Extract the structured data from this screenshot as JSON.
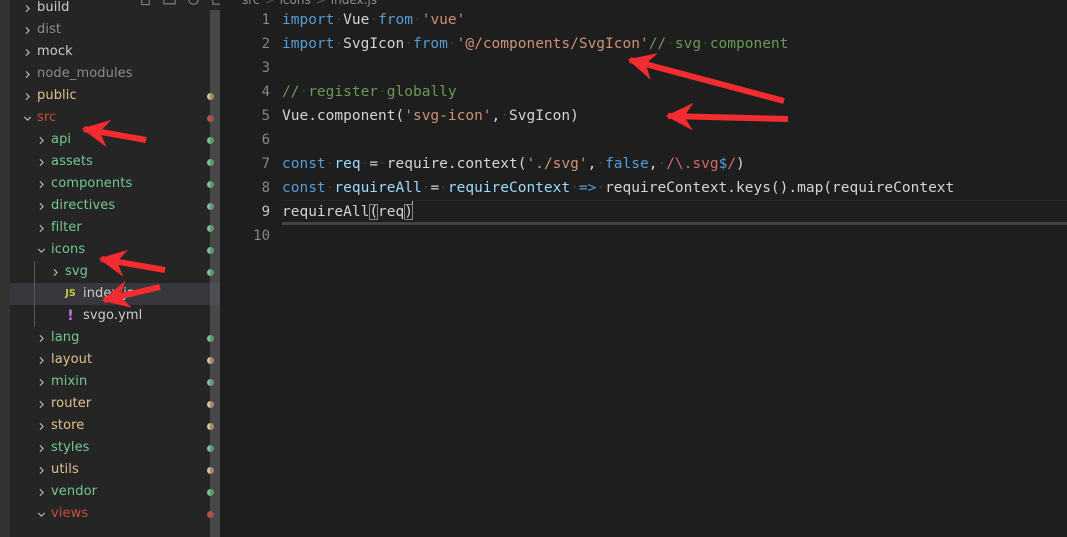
{
  "window": {
    "theme": "dark-plus",
    "accent_red": "#f22c30",
    "editor_bg": "#1e1e1e",
    "sidebar_bg": "#252526"
  },
  "toolbar": {
    "icons": [
      {
        "name": "new-file-icon",
        "glyph": "new-file"
      },
      {
        "name": "new-folder-icon",
        "glyph": "new-folder"
      },
      {
        "name": "refresh-explorer-icon",
        "glyph": "refresh"
      },
      {
        "name": "collapse-folders-icon",
        "glyph": "collapse"
      }
    ]
  },
  "breadcrumb": {
    "parts": [
      "src",
      "icons",
      "index.js"
    ]
  },
  "sidebar": {
    "scrollbar": {
      "name": "sidebar-scrollbar"
    },
    "items": [
      {
        "label": "build",
        "type": "folder",
        "state": "collapsed",
        "indent": 0,
        "color": "#cccccc",
        "dot": null,
        "selected": false
      },
      {
        "label": "dist",
        "type": "folder",
        "state": "collapsed",
        "indent": 0,
        "color": "#8c8c8c",
        "dot": null,
        "selected": false
      },
      {
        "label": "mock",
        "type": "folder",
        "state": "collapsed",
        "indent": 0,
        "color": "#cccccc",
        "dot": null,
        "selected": false
      },
      {
        "label": "node_modules",
        "type": "folder",
        "state": "collapsed",
        "indent": 0,
        "color": "#8c8c8c",
        "dot": null,
        "selected": false
      },
      {
        "label": "public",
        "type": "folder",
        "state": "collapsed",
        "indent": 0,
        "color": "#e2c08d",
        "dot": "#e2c08d",
        "selected": false
      },
      {
        "label": "src",
        "type": "folder",
        "state": "expanded",
        "indent": 0,
        "color": "#c74e39",
        "dot": "#c74e39",
        "selected": false
      },
      {
        "label": "api",
        "type": "folder",
        "state": "collapsed",
        "indent": 1,
        "color": "#73c991",
        "dot": "#73c991",
        "selected": false
      },
      {
        "label": "assets",
        "type": "folder",
        "state": "collapsed",
        "indent": 1,
        "color": "#73c991",
        "dot": "#73c991",
        "selected": false
      },
      {
        "label": "components",
        "type": "folder",
        "state": "collapsed",
        "indent": 1,
        "color": "#73c991",
        "dot": "#73c991",
        "selected": false
      },
      {
        "label": "directives",
        "type": "folder",
        "state": "collapsed",
        "indent": 1,
        "color": "#73c991",
        "dot": "#73c991",
        "selected": false
      },
      {
        "label": "filter",
        "type": "folder",
        "state": "collapsed",
        "indent": 1,
        "color": "#73c991",
        "dot": "#73c991",
        "selected": false
      },
      {
        "label": "icons",
        "type": "folder",
        "state": "expanded",
        "indent": 1,
        "color": "#73c991",
        "dot": "#73c991",
        "selected": false
      },
      {
        "label": "svg",
        "type": "folder",
        "state": "collapsed",
        "indent": 2,
        "color": "#73c991",
        "dot": "#73c991",
        "selected": false
      },
      {
        "label": "index.js",
        "type": "file",
        "state": "none",
        "indent": 2,
        "color": "#cccccc",
        "dot": null,
        "selected": true,
        "icon": "js"
      },
      {
        "label": "svgo.yml",
        "type": "file",
        "state": "none",
        "indent": 2,
        "color": "#cccccc",
        "dot": null,
        "selected": false,
        "icon": "yml"
      },
      {
        "label": "lang",
        "type": "folder",
        "state": "collapsed",
        "indent": 1,
        "color": "#73c991",
        "dot": "#73c991",
        "selected": false
      },
      {
        "label": "layout",
        "type": "folder",
        "state": "collapsed",
        "indent": 1,
        "color": "#e2c08d",
        "dot": "#e2c08d",
        "selected": false
      },
      {
        "label": "mixin",
        "type": "folder",
        "state": "collapsed",
        "indent": 1,
        "color": "#73c991",
        "dot": "#73c991",
        "selected": false
      },
      {
        "label": "router",
        "type": "folder",
        "state": "collapsed",
        "indent": 1,
        "color": "#e2c08d",
        "dot": "#e2c08d",
        "selected": false
      },
      {
        "label": "store",
        "type": "folder",
        "state": "collapsed",
        "indent": 1,
        "color": "#e2c08d",
        "dot": "#e2c08d",
        "selected": false
      },
      {
        "label": "styles",
        "type": "folder",
        "state": "collapsed",
        "indent": 1,
        "color": "#73c991",
        "dot": "#73c991",
        "selected": false
      },
      {
        "label": "utils",
        "type": "folder",
        "state": "collapsed",
        "indent": 1,
        "color": "#e2c08d",
        "dot": "#e2c08d",
        "selected": false
      },
      {
        "label": "vendor",
        "type": "folder",
        "state": "collapsed",
        "indent": 1,
        "color": "#73c991",
        "dot": "#73c991",
        "selected": false
      },
      {
        "label": "views",
        "type": "folder",
        "state": "expanded",
        "indent": 1,
        "color": "#c74e39",
        "dot": "#c74e39",
        "selected": false
      }
    ]
  },
  "editor": {
    "filename": "index.js",
    "language": "javascript",
    "active_line": 9,
    "lines": [
      {
        "no": "1",
        "tokens": [
          {
            "t": "import",
            "c": "t-kw"
          },
          {
            "t": "·",
            "c": "ws"
          },
          {
            "t": "Vue",
            "c": "t-plain"
          },
          {
            "t": "·",
            "c": "ws"
          },
          {
            "t": "from",
            "c": "t-kw"
          },
          {
            "t": "·",
            "c": "ws"
          },
          {
            "t": "'vue'",
            "c": "t-str"
          }
        ]
      },
      {
        "no": "2",
        "tokens": [
          {
            "t": "import",
            "c": "t-kw"
          },
          {
            "t": "·",
            "c": "ws"
          },
          {
            "t": "SvgIcon",
            "c": "t-plain"
          },
          {
            "t": "·",
            "c": "ws"
          },
          {
            "t": "from",
            "c": "t-kw"
          },
          {
            "t": "·",
            "c": "ws"
          },
          {
            "t": "'@/components/SvgIcon'",
            "c": "t-str"
          },
          {
            "t": "//",
            "c": "t-com"
          },
          {
            "t": "·",
            "c": "ws"
          },
          {
            "t": "svg",
            "c": "t-com"
          },
          {
            "t": "·",
            "c": "ws"
          },
          {
            "t": "component",
            "c": "t-com"
          }
        ]
      },
      {
        "no": "3",
        "tokens": []
      },
      {
        "no": "4",
        "tokens": [
          {
            "t": "//",
            "c": "t-com"
          },
          {
            "t": "·",
            "c": "ws"
          },
          {
            "t": "register",
            "c": "t-com"
          },
          {
            "t": "·",
            "c": "ws"
          },
          {
            "t": "globally",
            "c": "t-com"
          }
        ]
      },
      {
        "no": "5",
        "tokens": [
          {
            "t": "Vue",
            "c": "t-plain"
          },
          {
            "t": ".component(",
            "c": "t-plain"
          },
          {
            "t": "'svg-icon'",
            "c": "t-str"
          },
          {
            "t": ",",
            "c": "t-plain"
          },
          {
            "t": "·",
            "c": "ws"
          },
          {
            "t": "SvgIcon)",
            "c": "t-plain"
          }
        ]
      },
      {
        "no": "6",
        "tokens": []
      },
      {
        "no": "7",
        "tokens": [
          {
            "t": "const",
            "c": "t-kw"
          },
          {
            "t": "·",
            "c": "ws"
          },
          {
            "t": "req",
            "c": "t-def"
          },
          {
            "t": "·",
            "c": "ws"
          },
          {
            "t": "=",
            "c": "t-plain"
          },
          {
            "t": "·",
            "c": "ws"
          },
          {
            "t": "require.context(",
            "c": "t-plain"
          },
          {
            "t": "'./svg'",
            "c": "t-str"
          },
          {
            "t": ",",
            "c": "t-plain"
          },
          {
            "t": "·",
            "c": "ws"
          },
          {
            "t": "false",
            "c": "t-kw"
          },
          {
            "t": ",",
            "c": "t-plain"
          },
          {
            "t": "·",
            "c": "ws"
          },
          {
            "t": "/\\.svg",
            "c": "t-regex"
          },
          {
            "t": "$",
            "c": "t-op"
          },
          {
            "t": "/",
            "c": "t-regex"
          },
          {
            "t": ")",
            "c": "t-plain"
          }
        ]
      },
      {
        "no": "8",
        "tokens": [
          {
            "t": "const",
            "c": "t-kw"
          },
          {
            "t": "·",
            "c": "ws"
          },
          {
            "t": "requireAll",
            "c": "t-def"
          },
          {
            "t": "·",
            "c": "ws"
          },
          {
            "t": "=",
            "c": "t-plain"
          },
          {
            "t": "·",
            "c": "ws"
          },
          {
            "t": "requireContext",
            "c": "t-def"
          },
          {
            "t": "·",
            "c": "ws"
          },
          {
            "t": "=>",
            "c": "t-op"
          },
          {
            "t": "·",
            "c": "ws"
          },
          {
            "t": "requireContext.keys().map(requireContext",
            "c": "t-plain"
          }
        ]
      },
      {
        "no": "9",
        "tokens": [
          {
            "t": "requireAll",
            "c": "t-plain"
          },
          {
            "t": "(",
            "c": "t-brkt",
            "match": true
          },
          {
            "t": "req",
            "c": "t-plain"
          },
          {
            "t": ")",
            "c": "t-brkt",
            "match": true
          }
        ]
      },
      {
        "no": "10",
        "tokens": []
      }
    ]
  },
  "annotations": {
    "arrow_color": "#f22c30",
    "arrows": [
      {
        "name": "arrow-pointing-to-src",
        "target": "src folder"
      },
      {
        "name": "arrow-pointing-to-icons",
        "target": "icons folder"
      },
      {
        "name": "arrow-pointing-to-index-js",
        "target": "index.js file"
      },
      {
        "name": "arrow-pointing-to-import-line",
        "target": "import SvgIcon line"
      },
      {
        "name": "arrow-pointing-to-register-line",
        "target": "Vue.component registration line"
      }
    ]
  }
}
